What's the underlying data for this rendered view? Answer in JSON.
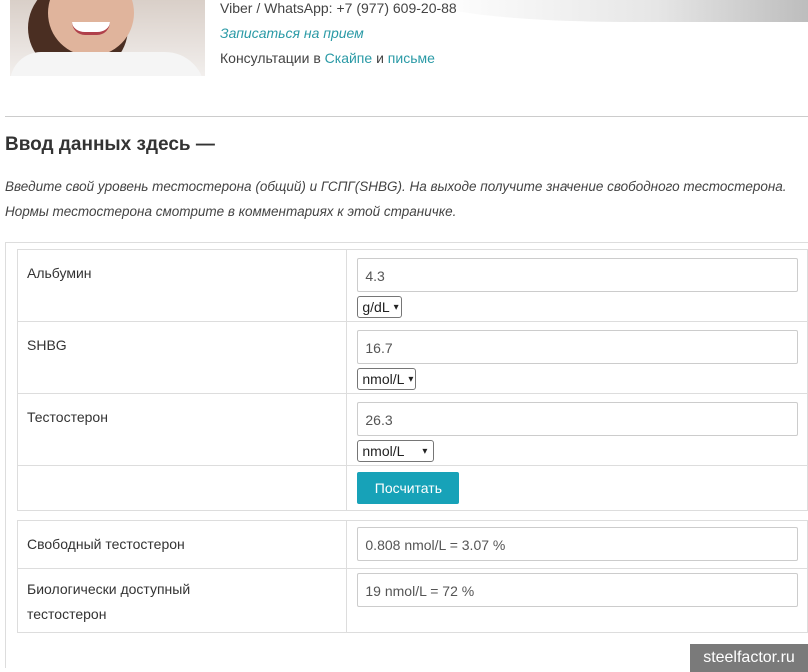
{
  "header": {
    "contact_phone": "Viber / WhatsApp: +7 (977) 609-20-88",
    "appointment_link": "Записаться на прием",
    "consult_prefix": "Консультации в",
    "consult_skype": "Скайпе",
    "consult_and": "и",
    "consult_mail": "письме"
  },
  "section": {
    "title": "Ввод данных здесь —",
    "intro_line1": "Введите свой уровень тестостерона (общий) и ГСПГ(SHBG). На выходе получите значение свободного тестостерона.",
    "intro_line2": "Нормы тестостерона смотрите в комментариях к этой страничке."
  },
  "form": {
    "albumin": {
      "label": "Альбумин",
      "value": "4.3",
      "unit": "g/dL"
    },
    "shbg": {
      "label": "SHBG",
      "value": "16.7",
      "unit": "nmol/L"
    },
    "testosterone": {
      "label": "Тестостерон",
      "value": "26.3",
      "unit": "nmol/L"
    },
    "calculate_button": "Посчитать"
  },
  "results": {
    "free": {
      "label": "Свободный тестостерон",
      "value": "0.808 nmol/L  =  3.07 %"
    },
    "bio": {
      "label_line1": "Биологически доступный",
      "label_line2": "тестостерон",
      "value": "19 nmol/L  =  72 %"
    }
  },
  "watermark": "steelfactor.ru",
  "icons": {
    "dropdown": "chevron-down-icon"
  },
  "colors": {
    "accent": "#17a2b8",
    "link": "#2a9aa6"
  }
}
